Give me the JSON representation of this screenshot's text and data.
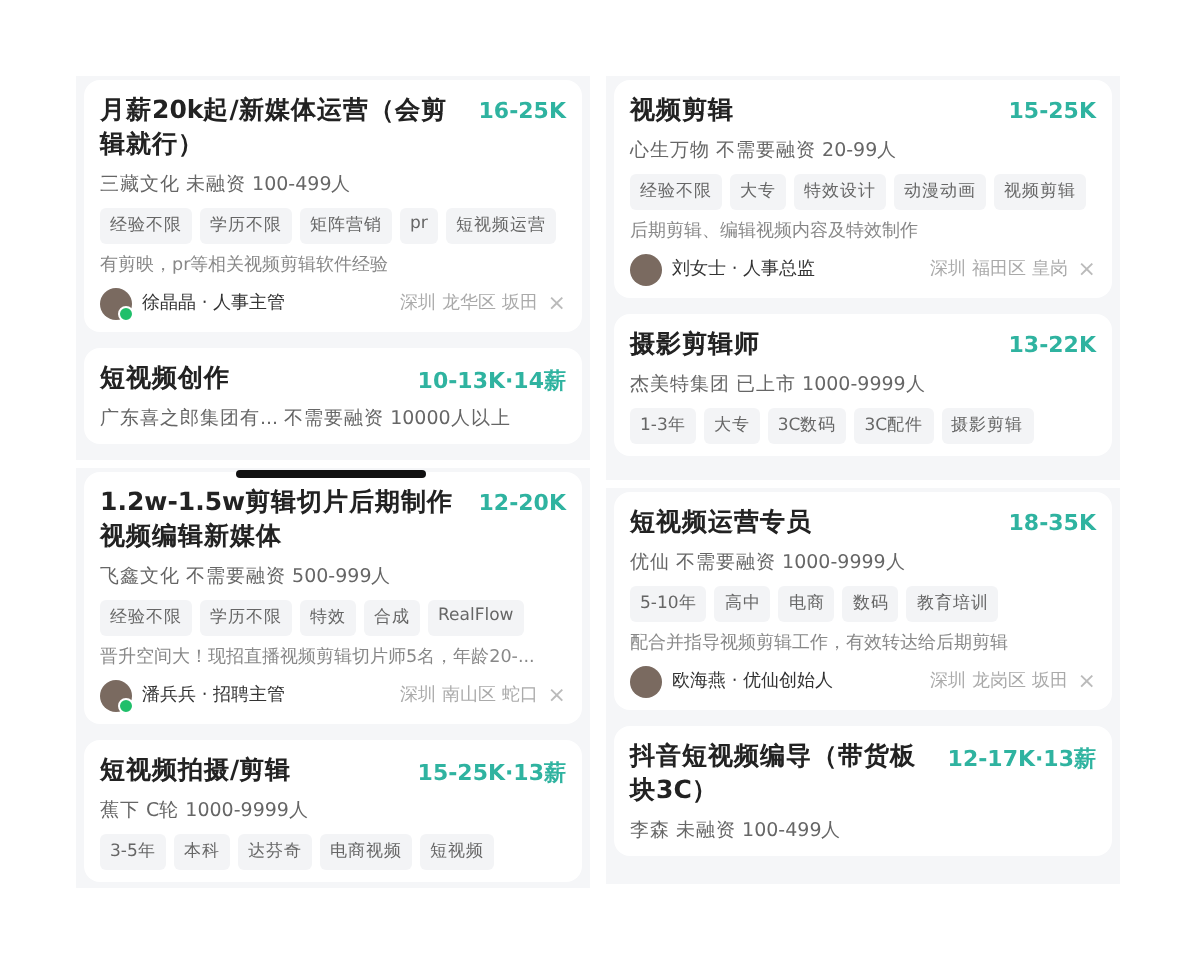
{
  "columns": [
    {
      "panels": [
        {
          "home_indicator": false,
          "cards": [
            {
              "title": "月薪20k起/新媒体运营（会剪辑就行）",
              "salary": "16-25K",
              "company": "三藏文化 未融资 100-499人",
              "tags": [
                "经验不限",
                "学历不限",
                "矩阵营销",
                "pr",
                "短视频运营"
              ],
              "description": "有剪映，pr等相关视频剪辑软件经验",
              "recruiter": {
                "name": "徐晶晶 · 人事主管",
                "online": true
              },
              "location": "深圳 龙华区 坂田",
              "close": "×"
            },
            {
              "title": "短视频创作",
              "salary": "10-13K·14薪",
              "company": "广东喜之郎集团有... 不需要融资 10000人以上"
            }
          ]
        },
        {
          "home_indicator": true,
          "cards": [
            {
              "title": "1.2w-1.5w剪辑切片后期制作视频编辑新媒体",
              "salary": "12-20K",
              "company": "飞鑫文化 不需要融资 500-999人",
              "tags": [
                "经验不限",
                "学历不限",
                "特效",
                "合成",
                "RealFlow"
              ],
              "description": "晋升空间大！现招直播视频剪辑切片师5名，年龄20-...",
              "recruiter": {
                "name": "潘兵兵 · 招聘主管",
                "online": true
              },
              "location": "深圳 南山区 蛇口",
              "close": "×"
            },
            {
              "title": "短视频拍摄/剪辑",
              "salary": "15-25K·13薪",
              "company": "蕉下 C轮 1000-9999人",
              "tags": [
                "3-5年",
                "本科",
                "达芬奇",
                "电商视频",
                "短视频"
              ]
            }
          ]
        }
      ]
    },
    {
      "panels": [
        {
          "home_indicator": false,
          "cards": [
            {
              "title": "视频剪辑",
              "salary": "15-25K",
              "company": "心生万物 不需要融资 20-99人",
              "tags": [
                "经验不限",
                "大专",
                "特效设计",
                "动漫动画",
                "视频剪辑"
              ],
              "description": "后期剪辑、编辑视频内容及特效制作",
              "recruiter": {
                "name": "刘女士 · 人事总监",
                "online": false
              },
              "location": "深圳 福田区 皇岗",
              "close": "×"
            },
            {
              "title": "摄影剪辑师",
              "salary": "13-22K",
              "company": "杰美特集团 已上市 1000-9999人",
              "tags": [
                "1-3年",
                "大专",
                "3C数码",
                "3C配件",
                "摄影剪辑"
              ]
            }
          ]
        },
        {
          "home_indicator": false,
          "cards": [
            {
              "title": "短视频运营专员",
              "salary": "18-35K",
              "company": "优仙 不需要融资 1000-9999人",
              "tags": [
                "5-10年",
                "高中",
                "电商",
                "数码",
                "教育培训"
              ],
              "description": "配合并指导视频剪辑工作，有效转达给后期剪辑",
              "recruiter": {
                "name": "欧海燕 · 优仙创始人",
                "online": false
              },
              "location": "深圳 龙岗区 坂田",
              "close": "×"
            },
            {
              "title": "抖音短视频编导（带货板块3C）",
              "salary": "12-17K·13薪",
              "company": "李森 未融资 100-499人"
            }
          ]
        }
      ]
    }
  ]
}
